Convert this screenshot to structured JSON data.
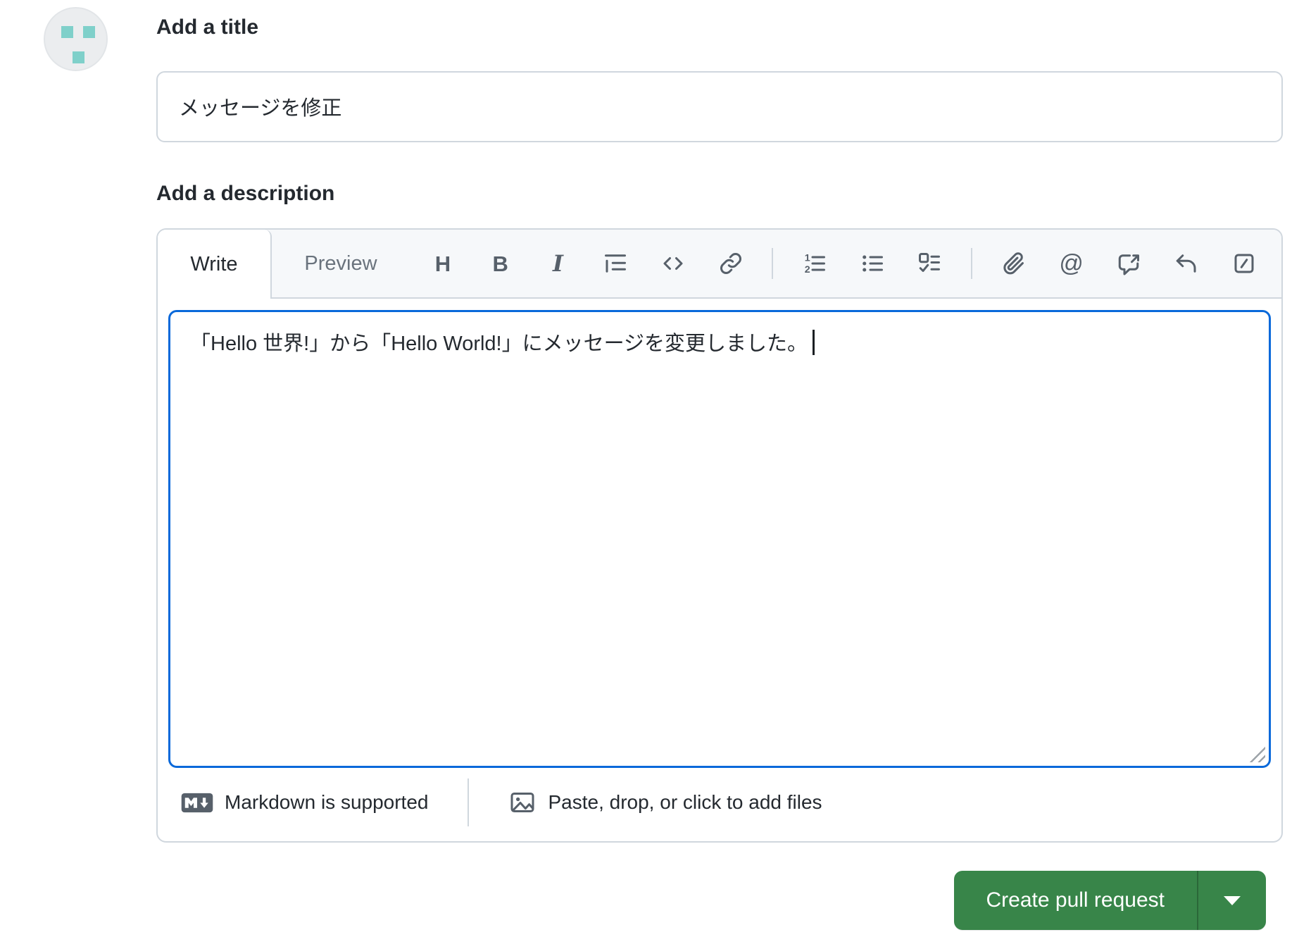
{
  "colors": {
    "accent-green": "#388549",
    "focus-blue": "#0969da",
    "border-gray": "#d0d7de",
    "header-bg": "#f6f8fa",
    "icon-gray": "#57606a",
    "text-primary": "#24292f",
    "text-muted": "#6a737d",
    "avatar-teal": "#7fd0ca",
    "avatar-bg": "#ebedef"
  },
  "title_section": {
    "heading": "Add a title",
    "input_value": "メッセージを修正"
  },
  "description_section": {
    "heading": "Add a description",
    "tabs": [
      {
        "label": "Write",
        "active": true
      },
      {
        "label": "Preview",
        "active": false
      }
    ],
    "toolbar_glyphs": {
      "heading": "H",
      "bold": "B",
      "italic": "I",
      "mention": "@"
    },
    "toolbar_icons": [
      "heading",
      "bold",
      "italic",
      "quote",
      "code",
      "link",
      "numbered-list",
      "bullet-list",
      "task-list",
      "attach-file",
      "mention",
      "cross-reference",
      "saved-reply",
      "slash-commands"
    ],
    "body_text": "「Hello 世界!」から「Hello World!」にメッセージを変更しました。",
    "footer": {
      "markdown_note": "Markdown is supported",
      "attach_note": "Paste, drop, or click to add files"
    }
  },
  "actions": {
    "create_label": "Create pull request"
  }
}
